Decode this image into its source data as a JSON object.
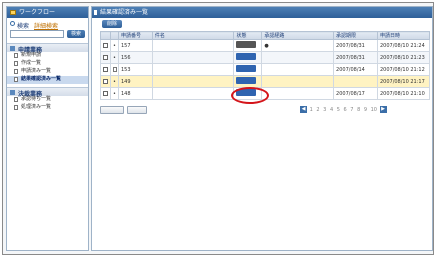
{
  "sidebar": {
    "title": "ワークフロー",
    "search_label": "検索",
    "advanced_search": "詳細検索",
    "search_button": "検索",
    "sections": [
      {
        "label": "申請業務",
        "items": [
          {
            "label": "新規申請"
          },
          {
            "label": "作成一覧"
          },
          {
            "label": "申請済み一覧"
          },
          {
            "label": "結果確認済み一覧",
            "selected": true
          }
        ]
      },
      {
        "label": "決裁業務",
        "items": [
          {
            "label": "承認待ち一覧"
          },
          {
            "label": "処理済み一覧"
          }
        ]
      }
    ]
  },
  "main": {
    "title": "結果確認済み一覧",
    "delete_button": "削除",
    "columns": [
      "",
      "",
      "申請番号",
      "件名",
      "状態",
      "承認経路",
      "承認期限",
      "申請日時"
    ],
    "rows": [
      {
        "no": "157",
        "subject": "",
        "status": "",
        "route": "",
        "deadline": "2007/08/31",
        "date": "2007/08/10 21:24"
      },
      {
        "no": "156",
        "subject": "",
        "status": "",
        "route": "",
        "deadline": "2007/08/31",
        "date": "2007/08/10 21:23"
      },
      {
        "no": "153",
        "subject": "",
        "status": "",
        "route": "",
        "deadline": "2007/08/14",
        "date": "2007/08/10 21:12"
      },
      {
        "no": "149",
        "subject": "",
        "status": "",
        "route": "",
        "deadline": "",
        "date": "2007/08/10 21:17"
      },
      {
        "no": "148",
        "subject": "",
        "status": "",
        "route": "",
        "deadline": "2007/08/17",
        "date": "2007/08/10 21:10"
      }
    ],
    "select_all_button": "",
    "deselect_button": "",
    "pager_pages": [
      "1",
      "2",
      "3",
      "4",
      "5",
      "6",
      "7",
      "8",
      "9",
      "10"
    ],
    "total": ""
  }
}
